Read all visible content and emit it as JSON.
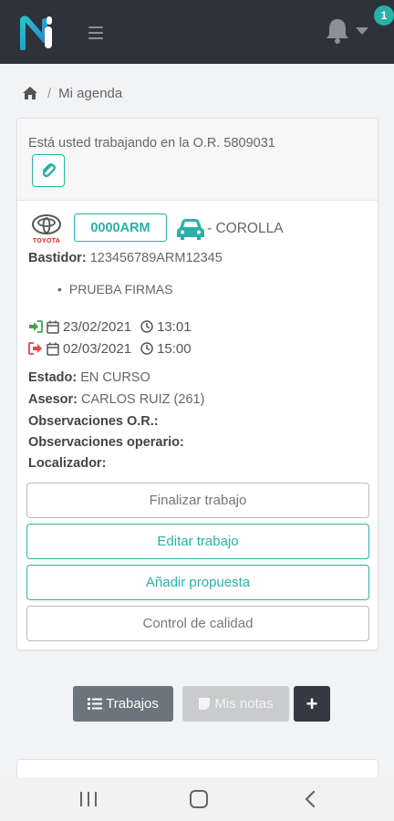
{
  "header": {
    "logo_icon": "app-logo-icon",
    "menu_icon": "hamburger-icon",
    "notifications_icon": "bell-icon",
    "notification_count": "1"
  },
  "breadcrumb": {
    "home_icon": "home-icon",
    "separator": "/",
    "current": "Mi agenda"
  },
  "work_order": {
    "banner_text": "Está usted trabajando en la O.R. 5809031",
    "attachment_icon": "paperclip-icon"
  },
  "vehicle": {
    "brand": "TOYOTA",
    "plate": "0000ARM",
    "car_icon": "car-icon",
    "model": "- COROLLA",
    "chassis_label": "Bastidor:",
    "chassis_value": "123456789ARM12345",
    "tasks": [
      "PRUEBA FIRMAS"
    ]
  },
  "schedule": {
    "entry_date": "23/02/2021",
    "entry_time": "13:01",
    "exit_date": "02/03/2021",
    "exit_time": "15:00"
  },
  "details": {
    "status_label": "Estado:",
    "status_value": "EN CURSO",
    "advisor_label": "Asesor:",
    "advisor_value": "CARLOS RUIZ (261)",
    "or_notes_label": "Observaciones O.R.:",
    "operator_notes_label": "Observaciones operario:",
    "locator_label": "Localizador:"
  },
  "actions": {
    "finish": "Finalizar trabajo",
    "edit": "Editar trabajo",
    "add_proposal": "Añadir propuesta",
    "quality_control": "Control de calidad"
  },
  "bottom_buttons": {
    "jobs": "Trabajos",
    "notes": "Mis notas",
    "add": "+"
  },
  "colors": {
    "accent": "#2ab0a8",
    "topbar": "#2e323b",
    "entry_green": "#3aa54a",
    "exit_red": "#e04848"
  }
}
